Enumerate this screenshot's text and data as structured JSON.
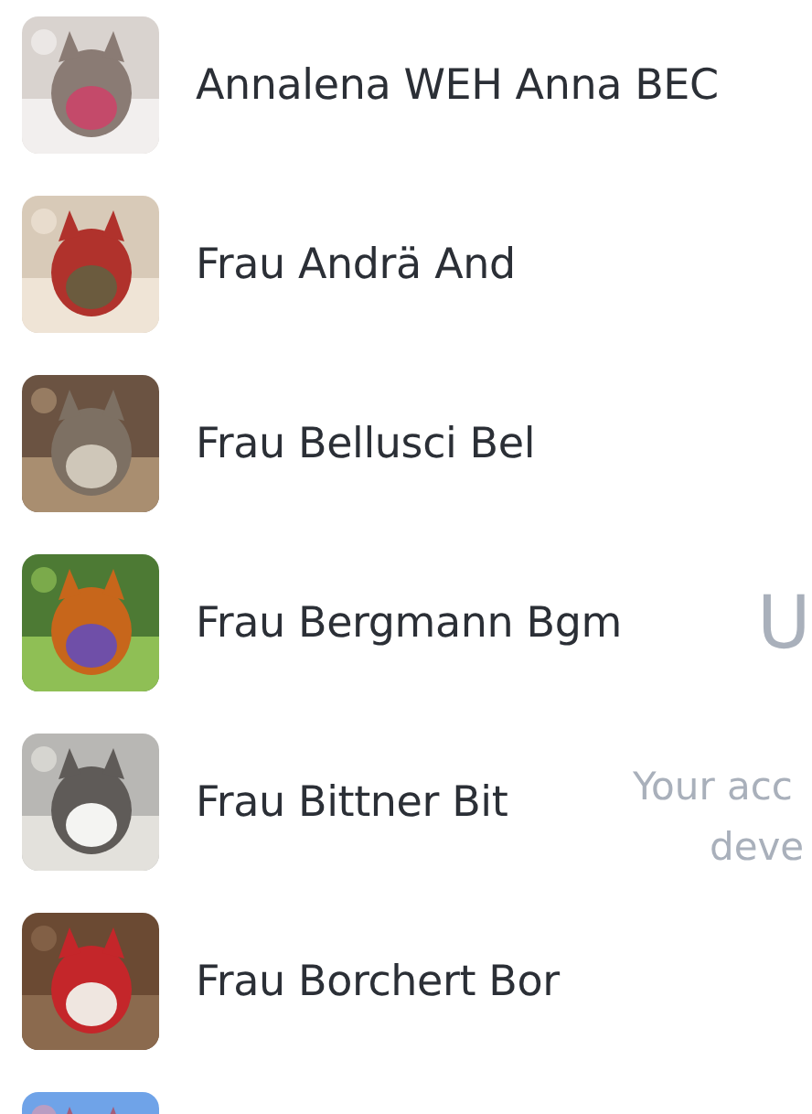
{
  "contacts": [
    {
      "name": "Annalena WEH Anna BEC",
      "avatar": {
        "kind": "picture"
      }
    },
    {
      "name": "Frau Andrä And",
      "avatar": {
        "kind": "picture"
      }
    },
    {
      "name": "Frau Bellusci Bel",
      "avatar": {
        "kind": "picture"
      }
    },
    {
      "name": "Frau Bergmann Bgm",
      "avatar": {
        "kind": "picture"
      }
    },
    {
      "name": "Frau Bittner Bit",
      "avatar": {
        "kind": "picture"
      }
    },
    {
      "name": "Frau Borchert Bor",
      "avatar": {
        "kind": "picture"
      }
    },
    {
      "avatar": {
        "kind": "picture"
      }
    }
  ],
  "background_panel": {
    "heading": "U",
    "text_lines": [
      "Your acc",
      "deve"
    ]
  }
}
